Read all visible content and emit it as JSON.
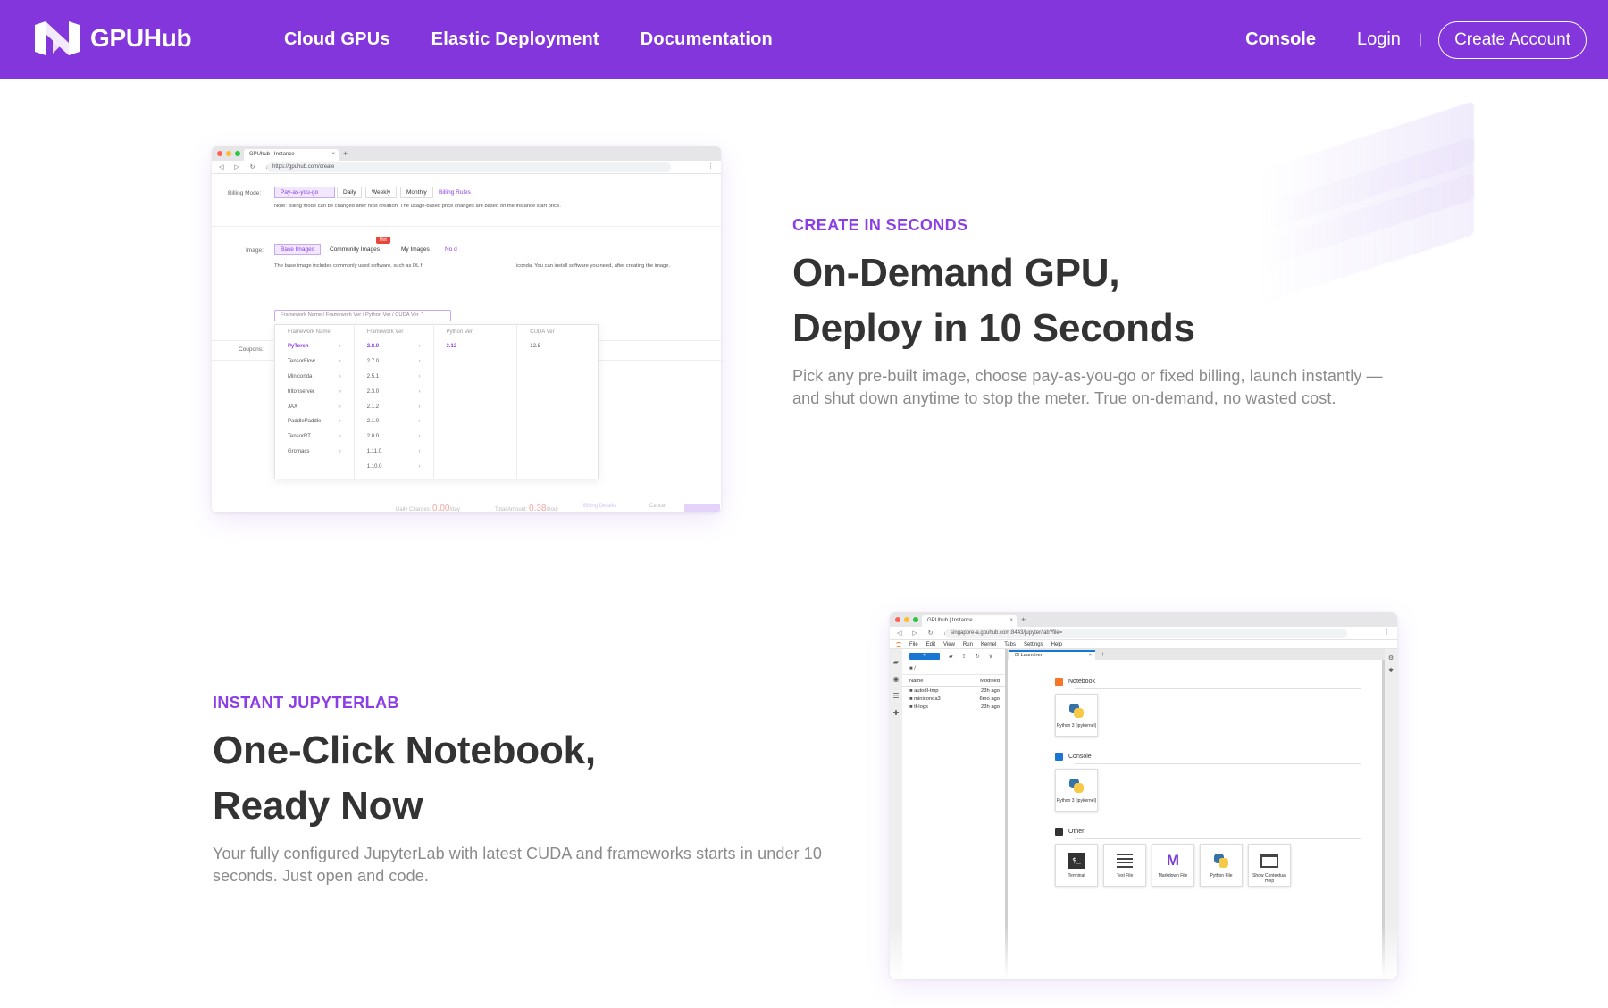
{
  "nav": {
    "brand": "GPUHub",
    "links": [
      "Cloud GPUs",
      "Elastic Deployment",
      "Documentation"
    ],
    "console": "Console",
    "login": "Login",
    "separator": "|",
    "create_account": "Create Account"
  },
  "section1": {
    "tag": "CREATE IN SECONDS",
    "headline_line1": "On-Demand GPU,",
    "headline_line2": "Deploy in 10 Seconds",
    "body": "Pick any pre-built image, choose pay-as-you-go or fixed billing, launch instantly — and shut down anytime to stop the meter. True on-demand, no wasted cost."
  },
  "section2": {
    "tag": "INSTANT JUPYTERLAB",
    "headline_line1": "One-Click Notebook,",
    "headline_line2": "Ready Now",
    "body": "Your fully configured JupyterLab with latest CUDA and frameworks starts in under 10 seconds. Just open and code."
  },
  "browser1": {
    "tab_title": "GPUhub | Instance",
    "url": "https://gpuhub.com/create",
    "billing_label": "Billing Mode:",
    "billing_options": [
      "Pay-as-you-go",
      "Daily",
      "Weekly",
      "Monthly"
    ],
    "billing_rules": "Billing Rules",
    "billing_note": "Note: Billing mode can be changed after host creation. The usage-based price changes are based on the instance start price.",
    "image_label": "Image:",
    "image_tabs": [
      "Base Images",
      "Community Images",
      "My Images"
    ],
    "hot_badge": "Hot",
    "no_data": "No d",
    "image_note_left": "The base image includes commonly used software, such as DL f",
    "image_note_right": "iconda. You can install software you need, after creating the image.",
    "select_placeholder": "Framework Name / Framework Ver / Python Ver / CUDA Ver",
    "coupons_label": "Coupons:",
    "dropdown": {
      "headers": [
        "Framework Name",
        "Framework Ver",
        "Python Ver",
        "CUDA Ver"
      ],
      "frameworks": [
        "PyTorch",
        "TensorFlow",
        "Miniconda",
        "tritonserver",
        "JAX",
        "PaddlePaddle",
        "TensorRT",
        "Gromacs"
      ],
      "versions": [
        "2.8.0",
        "2.7.0",
        "2.5.1",
        "2.3.0",
        "2.1.2",
        "2.1.0",
        "2.0.0",
        "1.11.0",
        "1.10.0"
      ],
      "python": [
        "3.12"
      ],
      "cuda": [
        "12.8"
      ]
    },
    "footer_daily": "Daily Charges: ",
    "footer_daily_val": "0.00",
    "footer_day": "/day",
    "footer_total": "Total Amount: ",
    "footer_total_val": "0.38",
    "footer_hour": "/hour",
    "footer_billing": "Billing Details",
    "footer_cancel": "Cancel"
  },
  "browser2": {
    "tab_title": "GPUhub | Instance",
    "url": "singapore-a.gpuhub.com:8443/jupyter/lab?file=",
    "menu": [
      "File",
      "Edit",
      "View",
      "Run",
      "Kernel",
      "Tabs",
      "Settings",
      "Help"
    ],
    "path": "■ /",
    "name_col": "Name",
    "modified_col": "Modified",
    "files": [
      {
        "name": "autodl-tmp",
        "modified": "23h ago"
      },
      {
        "name": "miniconda3",
        "modified": "6mo ago"
      },
      {
        "name": "tf-logs",
        "modified": "23h ago"
      }
    ],
    "launcher_tab": "Launcher",
    "sections": {
      "notebook": "Notebook",
      "console": "Console",
      "other": "Other"
    },
    "python_kernel": "Python 3 (ipykernel)",
    "other_items": [
      "Terminal",
      "Text File",
      "Markdown File",
      "Python File",
      "Show Contextual Help"
    ]
  },
  "colors": {
    "brand": "#8236dc",
    "accent": "#8b3de6",
    "headline": "#333333",
    "body": "#8a8a8a"
  }
}
